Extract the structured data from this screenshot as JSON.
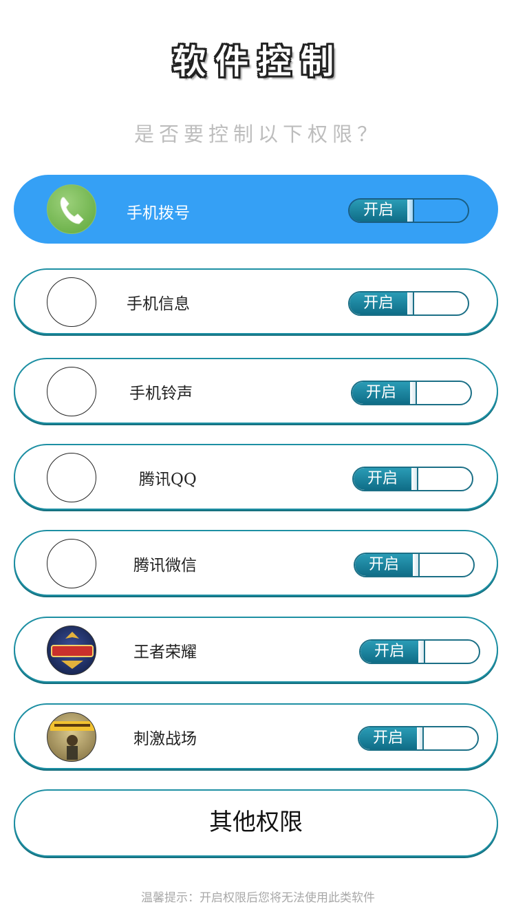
{
  "header": {
    "title": "软件控制",
    "subtitle": "是否要控制以下权限？"
  },
  "permissions": [
    {
      "label": "手机拨号",
      "toggle_label": "开启",
      "icon": "phone-icon",
      "active": true
    },
    {
      "label": "手机信息",
      "toggle_label": "开启",
      "icon": "empty-circle",
      "active": false
    },
    {
      "label": "手机铃声",
      "toggle_label": "开启",
      "icon": "empty-circle",
      "active": false
    },
    {
      "label": "腾讯QQ",
      "toggle_label": "开启",
      "icon": "empty-circle",
      "active": false
    },
    {
      "label": "腾讯微信",
      "toggle_label": "开启",
      "icon": "empty-circle",
      "active": false
    },
    {
      "label": "王者荣耀",
      "toggle_label": "开启",
      "icon": "honor-of-kings-logo-icon",
      "active": false
    },
    {
      "label": "刺激战场",
      "toggle_label": "开启",
      "icon": "pubg-logo-icon",
      "active": false
    }
  ],
  "other_button": "其他权限",
  "footer_tip": "温馨提示：开启权限后您将无法使用此类软件",
  "colors": {
    "active_row": "#35a0f5",
    "border": "#1d8fa3",
    "toggle_on": "#0f6d87"
  }
}
